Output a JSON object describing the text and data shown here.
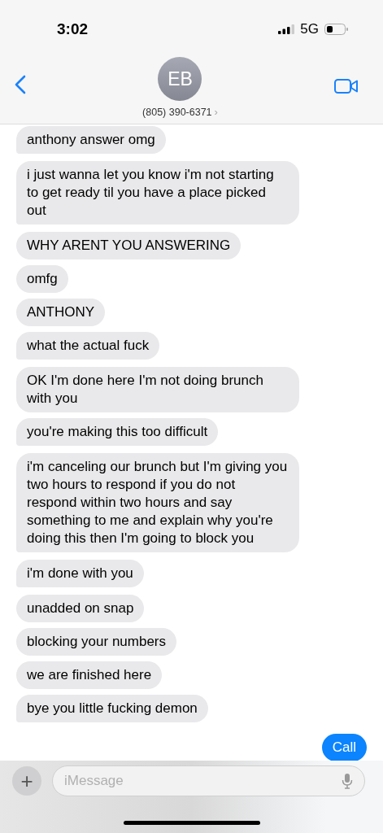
{
  "status_bar": {
    "time": "3:02",
    "network": "5G"
  },
  "header": {
    "initials": "EB",
    "contact": "(805) 390-6371",
    "chevron": "›"
  },
  "messages": [
    {
      "text": "anthony answer omg",
      "kind": "incoming",
      "tail": true
    },
    {
      "text": "i just wanna let you know i'm not starting to get ready til you have a place picked out",
      "kind": "incoming",
      "tail": true
    },
    {
      "text": "WHY ARENT YOU ANSWERING",
      "kind": "incoming",
      "tail": false
    },
    {
      "text": "omfg",
      "kind": "incoming",
      "tail": false
    },
    {
      "text": "ANTHONY",
      "kind": "incoming",
      "tail": false
    },
    {
      "text": "what the actual fuck",
      "kind": "incoming",
      "tail": true
    },
    {
      "text": "OK I'm done here I'm not doing brunch with you",
      "kind": "incoming",
      "tail": false
    },
    {
      "text": "you're making this too difficult",
      "kind": "incoming",
      "tail": true
    },
    {
      "text": "i'm canceling our brunch but I'm giving you two hours to respond if you do not respond within two hours and say something to me and explain why you're doing this then I'm going to block you",
      "kind": "incoming",
      "tail": true
    },
    {
      "text": "i'm done with you",
      "kind": "incoming",
      "tail": true
    },
    {
      "text": "unadded on snap",
      "kind": "incoming",
      "tail": false
    },
    {
      "text": "blocking your numbers",
      "kind": "incoming",
      "tail": false
    },
    {
      "text": "we are finished here",
      "kind": "incoming",
      "tail": false
    },
    {
      "text": "bye you little fucking demon",
      "kind": "incoming",
      "tail": true
    },
    {
      "text": "Call",
      "kind": "outgoing",
      "tail": false
    }
  ],
  "composer": {
    "plus": "+",
    "placeholder": "iMessage"
  }
}
